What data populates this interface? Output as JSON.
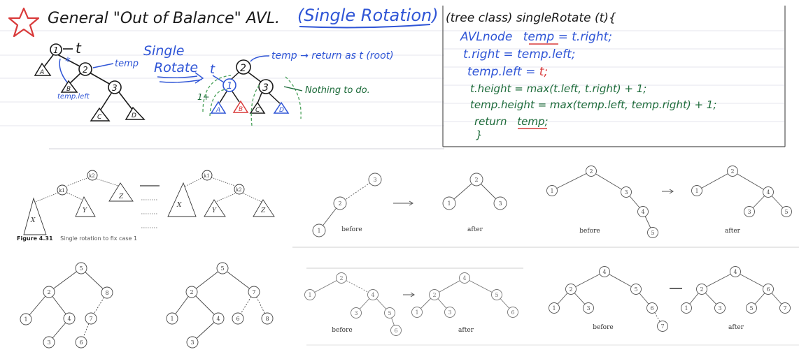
{
  "colors": {
    "ink": "#1a1a1a",
    "blue": "#2f55d6",
    "green": "#1d6b3a",
    "red": "#d93a3a",
    "grey_line": "#9a9a9a",
    "dash_green": "#4aa15a"
  },
  "notes": {
    "star_icon": "star-icon",
    "heading_main": "General \"Out of Balance\" AVL.",
    "heading_tag": "(Single Rotation)",
    "sketch": {
      "t_label": "t",
      "temp_label": "temp",
      "temp_left_label": "temp.left",
      "single_rotate": [
        "Single",
        "Rotate"
      ],
      "t_arrow_label": "t",
      "return_note": "temp → return as t (root)",
      "nothing_note": "Nothing to do.",
      "one_plus": "1+",
      "nodes": {
        "n1": "1",
        "n2": "2",
        "n3": "3"
      },
      "leaves": {
        "A": "A",
        "B": "B",
        "C": "C",
        "D": "D"
      }
    },
    "code": {
      "signature": "(tree class) singleRotate (t){",
      "lines": [
        {
          "text": "AVLnode",
          "extra": "temp",
          "rest": " = t.right;",
          "color": "blue"
        },
        {
          "text": "t.right = temp.left;",
          "color": "blue"
        },
        {
          "text": "temp.left = ",
          "extra": "t;",
          "color": "blue"
        },
        {
          "text": "t.height = max(t.left, t.right) + 1;",
          "color": "green"
        },
        {
          "text": "temp.height = max(temp.left, temp.right) + 1;",
          "color": "green"
        },
        {
          "text": "return",
          "extra": "temp;",
          "color": "green"
        },
        {
          "text": "}",
          "color": "green"
        }
      ]
    }
  },
  "figures": {
    "figure_4_31": {
      "caption_bold": "Figure 4.31",
      "caption_text": "Single rotation to fix case 1",
      "nodes": {
        "k2": "k2",
        "k1": "k1"
      },
      "subtrees": {
        "X": "X",
        "Y": "Y",
        "Z": "Z"
      }
    },
    "ex1": {
      "before_label": "before",
      "after_label": "after",
      "before_nodes": [
        "3",
        "2",
        "1"
      ],
      "after_nodes": [
        "2",
        "1",
        "3"
      ]
    },
    "ex2": {
      "before_label": "before",
      "after_label": "after",
      "before_nodes": [
        "2",
        "1",
        "3",
        "4",
        "5"
      ],
      "after_nodes": [
        "2",
        "1",
        "4",
        "3",
        "5"
      ]
    },
    "ex3": {
      "left_nodes": [
        "5",
        "2",
        "8",
        "1",
        "4",
        "7",
        "3",
        "6"
      ],
      "right_nodes": [
        "5",
        "2",
        "7",
        "1",
        "4",
        "6",
        "8",
        "3"
      ]
    },
    "ex4": {
      "before_label": "before",
      "after_label": "after",
      "before_nodes": [
        "2",
        "1",
        "4",
        "3",
        "5",
        "6"
      ],
      "after_nodes": [
        "4",
        "2",
        "5",
        "1",
        "3",
        "6"
      ]
    },
    "ex5": {
      "before_label": "before",
      "after_label": "after",
      "before_nodes": [
        "4",
        "2",
        "5",
        "1",
        "3",
        "6",
        "7"
      ],
      "after_nodes": [
        "4",
        "2",
        "6",
        "1",
        "3",
        "5",
        "7"
      ]
    }
  }
}
